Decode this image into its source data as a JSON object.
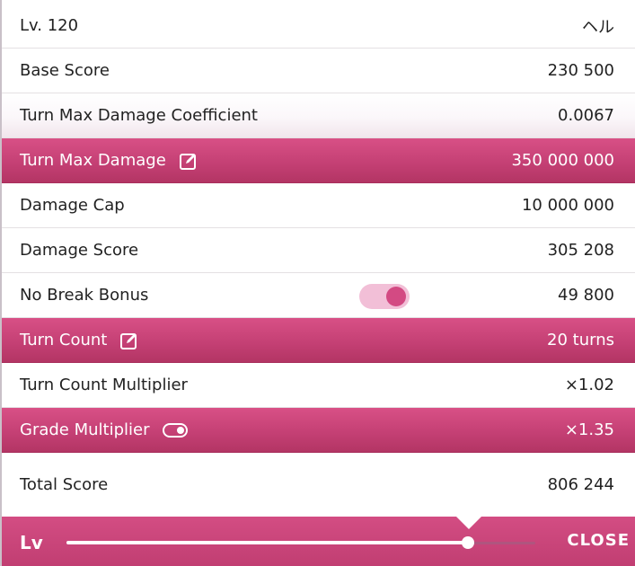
{
  "header": {
    "level": "Lv. 120",
    "character": "ヘル"
  },
  "rows": [
    {
      "label": "Base Score",
      "value": "230 500"
    },
    {
      "label": "Turn Max Damage Coefficient",
      "value": "0.0067"
    },
    {
      "label": "Turn Max Damage",
      "value": "350 000 000",
      "icon": "edit-icon"
    },
    {
      "label": "Damage Cap",
      "value": "10 000 000"
    },
    {
      "label": "Damage Score",
      "value": "305 208"
    },
    {
      "label": "No Break Bonus",
      "value": "49 800",
      "toggle_on": true
    },
    {
      "label": "Turn Count",
      "value": "20 turns",
      "icon": "edit-icon"
    },
    {
      "label": "Turn Count Multiplier",
      "value": "×1.02"
    },
    {
      "label": "Grade Multiplier",
      "value": "×1.35",
      "icon": "toggle-icon"
    }
  ],
  "total": {
    "label": "Total Score",
    "value": "806 244"
  },
  "footer": {
    "slider_label": "Lv",
    "slider_fraction": 0.856,
    "close_label": "CLOSE"
  },
  "colors": {
    "accent": "#c33f73",
    "toggle_track": "#f2bfd7",
    "toggle_knob": "#d34a83"
  }
}
